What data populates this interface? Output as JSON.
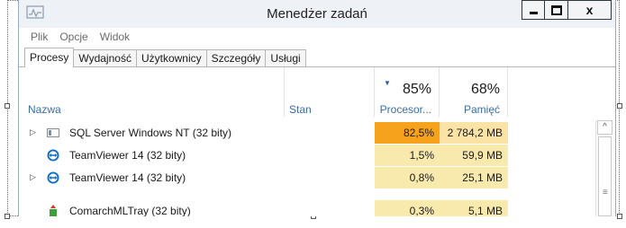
{
  "window": {
    "title": "Menedżer zadań",
    "app_icon": "task-manager-icon",
    "controls": [
      "minimize-icon",
      "maximize-icon",
      "close-icon"
    ],
    "close_glyph": "x"
  },
  "menu": [
    "Plik",
    "Opcje",
    "Widok"
  ],
  "tabs": {
    "items": [
      "Procesy",
      "Wydajność",
      "Użytkownicy",
      "Szczegóły",
      "Usługi"
    ],
    "active": "Procesy"
  },
  "columns": {
    "name": "Nazwa",
    "status": "Stan",
    "cpu_pct": "85%",
    "cpu_label": "Procesor...",
    "mem_pct": "68%",
    "mem_label": "Pamięć"
  },
  "rows": [
    {
      "name": "SQL Server Windows NT (32 bity)",
      "icon": "sql-server-icon",
      "expandable": true,
      "cpu": "82,5%",
      "mem": "2 784,2 MB"
    },
    {
      "name": "TeamViewer 14 (32 bity)",
      "icon": "teamviewer-icon",
      "expandable": false,
      "cpu": "1,5%",
      "mem": "59,9 MB"
    },
    {
      "name": "TeamViewer 14 (32 bity)",
      "icon": "teamviewer-icon",
      "expandable": true,
      "cpu": "0,8%",
      "mem": "25,1 MB"
    },
    {
      "name": "ComarchMLTray (32 bity)",
      "icon": "comarch-tray-icon",
      "expandable": false,
      "cpu": "0,3%",
      "mem": "5,1 MB"
    }
  ],
  "colors": {
    "cpu_high": "#f7a21c",
    "mem_high": "#fbe3a6",
    "cpu_low": "#f8e9ad",
    "mem_low": "#f8e9ad",
    "header_link": "#3a6ea5"
  }
}
